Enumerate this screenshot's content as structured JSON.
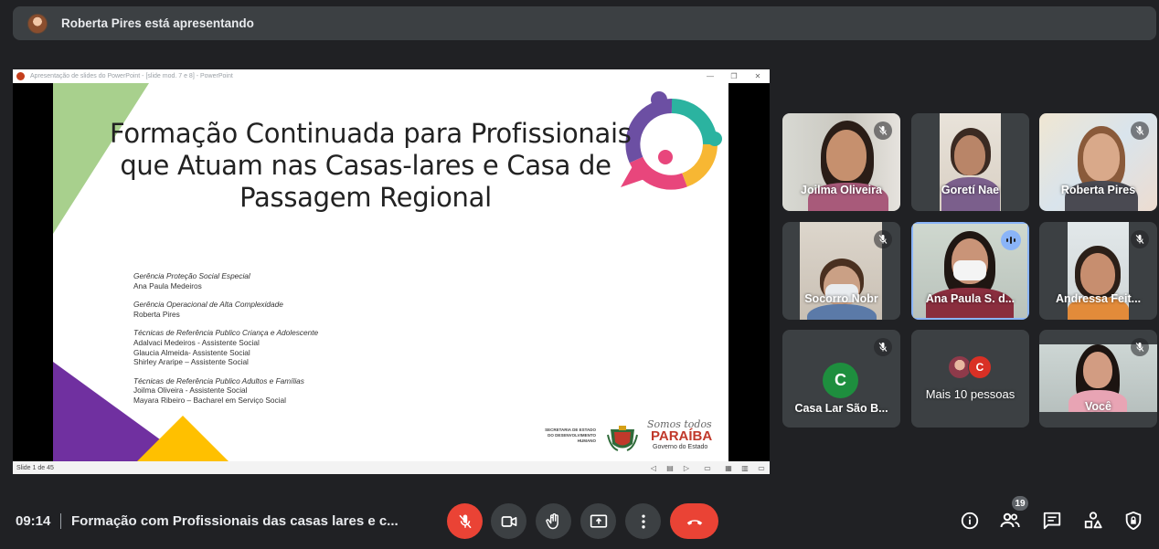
{
  "presenter": {
    "text": "Roberta Pires está apresentando"
  },
  "ppt": {
    "window_title": "Apresentação de slides do PowerPoint - [slide mod. 7 e 8] - PowerPoint",
    "status_slide": "Slide 1 de 45",
    "slide": {
      "title_lines": [
        "Formação Continuada para Profissionais",
        "que Atuam nas Casas-lares e Casa de",
        "Passagem Regional"
      ],
      "credits": [
        {
          "heading": "Gerência Proteção Social Especial",
          "lines": [
            "Ana Paula Medeiros"
          ]
        },
        {
          "heading": "Gerência Operacional de Alta Complexidade",
          "lines": [
            "Roberta Pires"
          ]
        },
        {
          "heading": "Técnicas de Referência Publico Criança e Adolescente",
          "lines": [
            "Adalvaci Medeiros - Assistente Social",
            "Glaucia Almeida- Assistente Social",
            "Shirley Araripe – Assistente Social"
          ]
        },
        {
          "heading": "Técnicas de Referência Publico Adultos e Famílias",
          "lines": [
            "Joilma Oliveira - Assistente Social",
            "Mayara Ribeiro – Bacharel em Serviço Social"
          ]
        }
      ],
      "secretaria_lines": [
        "SECRETARIA DE ESTADO",
        "DO DESENVOLVIMENTO",
        "HUMANO"
      ],
      "somos": "Somos todos",
      "paraiba": "PARAÍBA",
      "governo": "Governo do Estado"
    }
  },
  "participants": [
    {
      "name": "Joilma Oliveira"
    },
    {
      "name": "Goretí Nae"
    },
    {
      "name": "Roberta Pires"
    },
    {
      "name": "Socorro Nobr"
    },
    {
      "name": "Ana Paula S. d..."
    },
    {
      "name": "Andressa Feit..."
    },
    {
      "name": "Casa Lar São B...",
      "initial": "C"
    },
    {
      "name": "Mais 10 pessoas",
      "initial": "C"
    },
    {
      "name": "Você"
    }
  ],
  "bottom": {
    "time": "09:14",
    "meeting_title": "Formação com Profissionais das casas lares e c...",
    "participant_count": "19"
  },
  "colors": {
    "accent": "#8ab4f8",
    "danger": "#ea4335",
    "tile_bg": "#3c4043",
    "bg": "#202124"
  }
}
